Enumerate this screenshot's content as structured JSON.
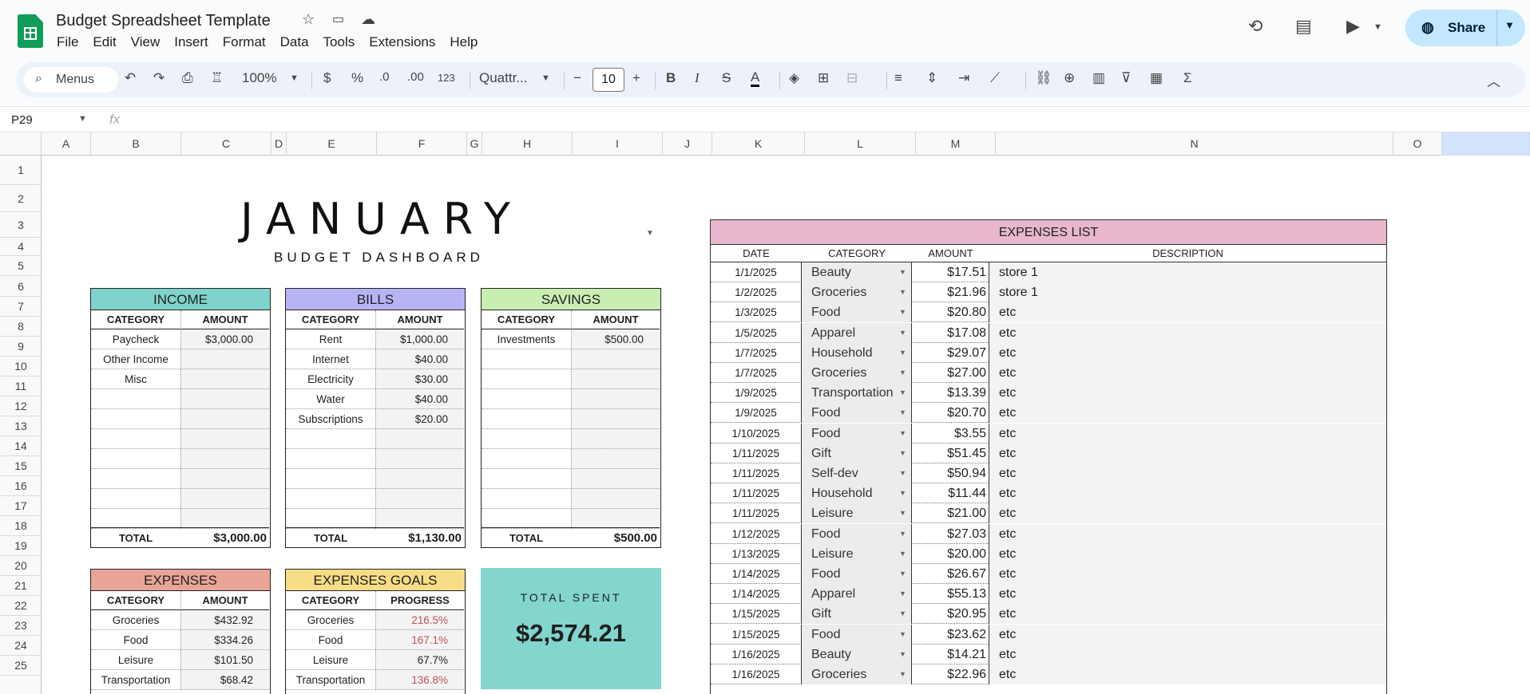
{
  "doc": {
    "title": "Budget Spreadsheet Template"
  },
  "menu": [
    "File",
    "Edit",
    "View",
    "Insert",
    "Format",
    "Data",
    "Tools",
    "Extensions",
    "Help"
  ],
  "share_label": "Share",
  "toolbar": {
    "menus": "Menus",
    "zoom": "100%",
    "currency": "$",
    "percent": "%",
    "dec_less": ".0",
    "dec_more": ".00",
    "format_123": "123",
    "font": "Quattr...",
    "font_size": "10"
  },
  "name_box": "P29",
  "columns": [
    "A",
    "B",
    "C",
    "D",
    "E",
    "F",
    "G",
    "H",
    "I",
    "J",
    "K",
    "L",
    "M",
    "N",
    "O"
  ],
  "rows": [
    "1",
    "2",
    "3",
    "4",
    "5",
    "6",
    "7",
    "8",
    "9",
    "10",
    "11",
    "12",
    "13",
    "14",
    "15",
    "16",
    "17",
    "18",
    "19",
    "20",
    "21",
    "22",
    "23",
    "24",
    "25"
  ],
  "dashboard": {
    "month": "JANUARY",
    "subtitle": "BUDGET DASHBOARD"
  },
  "income": {
    "title": "INCOME",
    "col1": "CATEGORY",
    "col2": "AMOUNT",
    "rows": [
      [
        "Paycheck",
        "$3,000.00"
      ],
      [
        "Other Income",
        ""
      ],
      [
        "Misc",
        ""
      ]
    ],
    "total_label": "TOTAL",
    "total": "$3,000.00",
    "header_color": "#7fd3cc"
  },
  "bills": {
    "title": "BILLS",
    "col1": "CATEGORY",
    "col2": "AMOUNT",
    "rows": [
      [
        "Rent",
        "$1,000.00"
      ],
      [
        "Internet",
        "$40.00"
      ],
      [
        "Electricity",
        "$30.00"
      ],
      [
        "Water",
        "$40.00"
      ],
      [
        "Subscriptions",
        "$20.00"
      ]
    ],
    "total_label": "TOTAL",
    "total": "$1,130.00",
    "header_color": "#b7b4f5"
  },
  "savings": {
    "title": "SAVINGS",
    "col1": "CATEGORY",
    "col2": "AMOUNT",
    "rows": [
      [
        "Investments",
        "$500.00"
      ]
    ],
    "total_label": "TOTAL",
    "total": "$500.00",
    "header_color": "#c9eeb2"
  },
  "expenses": {
    "title": "EXPENSES",
    "col1": "CATEGORY",
    "col2": "AMOUNT",
    "rows": [
      [
        "Groceries",
        "$432.92"
      ],
      [
        "Food",
        "$334.26"
      ],
      [
        "Leisure",
        "$101.50"
      ],
      [
        "Transportation",
        "$68.42"
      ]
    ],
    "header_color": "#e8a597"
  },
  "goals": {
    "title": "EXPENSES GOALS",
    "col1": "CATEGORY",
    "col2": "PROGRESS",
    "rows": [
      [
        "Groceries",
        "216.5%"
      ],
      [
        "Food",
        "167.1%"
      ],
      [
        "Leisure",
        "67.7%"
      ],
      [
        "Transportation",
        "136.8%"
      ]
    ],
    "header_color": "#f6dd86"
  },
  "total_spent": {
    "label": "TOTAL SPENT",
    "value": "$2,574.21"
  },
  "expenses_list": {
    "title": "EXPENSES LIST",
    "headers": [
      "DATE",
      "CATEGORY",
      "AMOUNT",
      "DESCRIPTION"
    ],
    "rows": [
      [
        "1/1/2025",
        "Beauty",
        "$17.51",
        "store 1"
      ],
      [
        "1/2/2025",
        "Groceries",
        "$21.96",
        "store 1"
      ],
      [
        "1/3/2025",
        "Food",
        "$20.80",
        "etc"
      ],
      [
        "1/5/2025",
        "Apparel",
        "$17.08",
        "etc"
      ],
      [
        "1/7/2025",
        "Household",
        "$29.07",
        "etc"
      ],
      [
        "1/7/2025",
        "Groceries",
        "$27.00",
        "etc"
      ],
      [
        "1/9/2025",
        "Transportation",
        "$13.39",
        "etc"
      ],
      [
        "1/9/2025",
        "Food",
        "$20.70",
        "etc"
      ],
      [
        "1/10/2025",
        "Food",
        "$3.55",
        "etc"
      ],
      [
        "1/11/2025",
        "Gift",
        "$51.45",
        "etc"
      ],
      [
        "1/11/2025",
        "Self-dev",
        "$50.94",
        "etc"
      ],
      [
        "1/11/2025",
        "Household",
        "$11.44",
        "etc"
      ],
      [
        "1/11/2025",
        "Leisure",
        "$21.00",
        "etc"
      ],
      [
        "1/12/2025",
        "Food",
        "$27.03",
        "etc"
      ],
      [
        "1/13/2025",
        "Leisure",
        "$20.00",
        "etc"
      ],
      [
        "1/14/2025",
        "Food",
        "$26.67",
        "etc"
      ],
      [
        "1/14/2025",
        "Apparel",
        "$55.13",
        "etc"
      ],
      [
        "1/15/2025",
        "Gift",
        "$20.95",
        "etc"
      ],
      [
        "1/15/2025",
        "Food",
        "$23.62",
        "etc"
      ],
      [
        "1/16/2025",
        "Beauty",
        "$14.21",
        "etc"
      ],
      [
        "1/16/2025",
        "Groceries",
        "$22.96",
        "etc"
      ]
    ]
  }
}
